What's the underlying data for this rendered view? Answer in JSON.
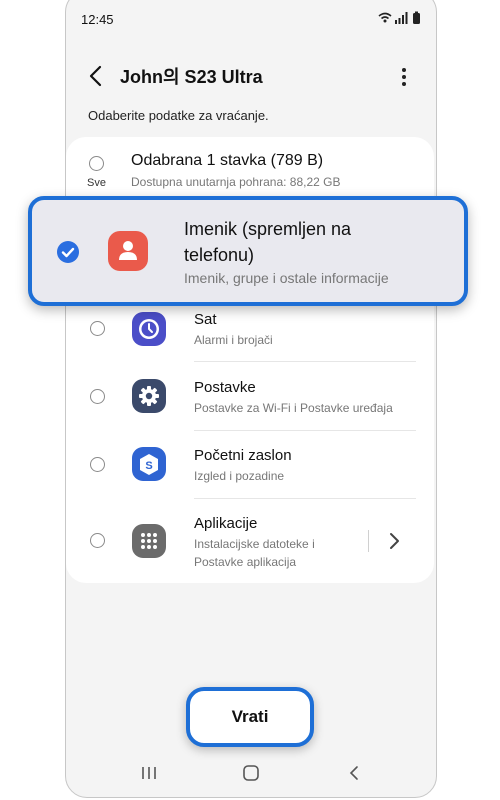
{
  "status_bar": {
    "time": "12:45"
  },
  "header": {
    "title": "John의 S23 Ultra"
  },
  "subtitle": "Odaberite podatke za vraćanje.",
  "select_all": {
    "label": "Sve",
    "title": "Odabrana 1 stavka (789 B)",
    "storage": "Dostupna unutarnja pohrana: 88,22 GB"
  },
  "contacts": {
    "title": "Imenik (spremljen na telefonu)",
    "subtitle": "Imenik, grupe i ostale informacije",
    "checked": true,
    "accent": "#1e6fd6",
    "icon_color": "#ea5a4b"
  },
  "items": [
    {
      "title": "Sat",
      "subtitle": "Alarmi i brojači",
      "icon": "clock-icon",
      "color": "#4b4ec8"
    },
    {
      "title": "Postavke",
      "subtitle": "Postavke za Wi-Fi i Postavke uređaja",
      "icon": "gear-icon",
      "color": "#3b4a6b"
    },
    {
      "title": "Početni zaslon",
      "subtitle": "Izgled i pozadine",
      "icon": "home-screen-icon",
      "color": "#2f64d2"
    },
    {
      "title": "Aplikacije",
      "subtitle_line1": "Instalacijske datoteke i",
      "subtitle_line2": "Postavke aplikacija",
      "icon": "apps-grid-icon",
      "color": "#6b6b6b"
    }
  ],
  "restore_button": {
    "label": "Vrati"
  }
}
